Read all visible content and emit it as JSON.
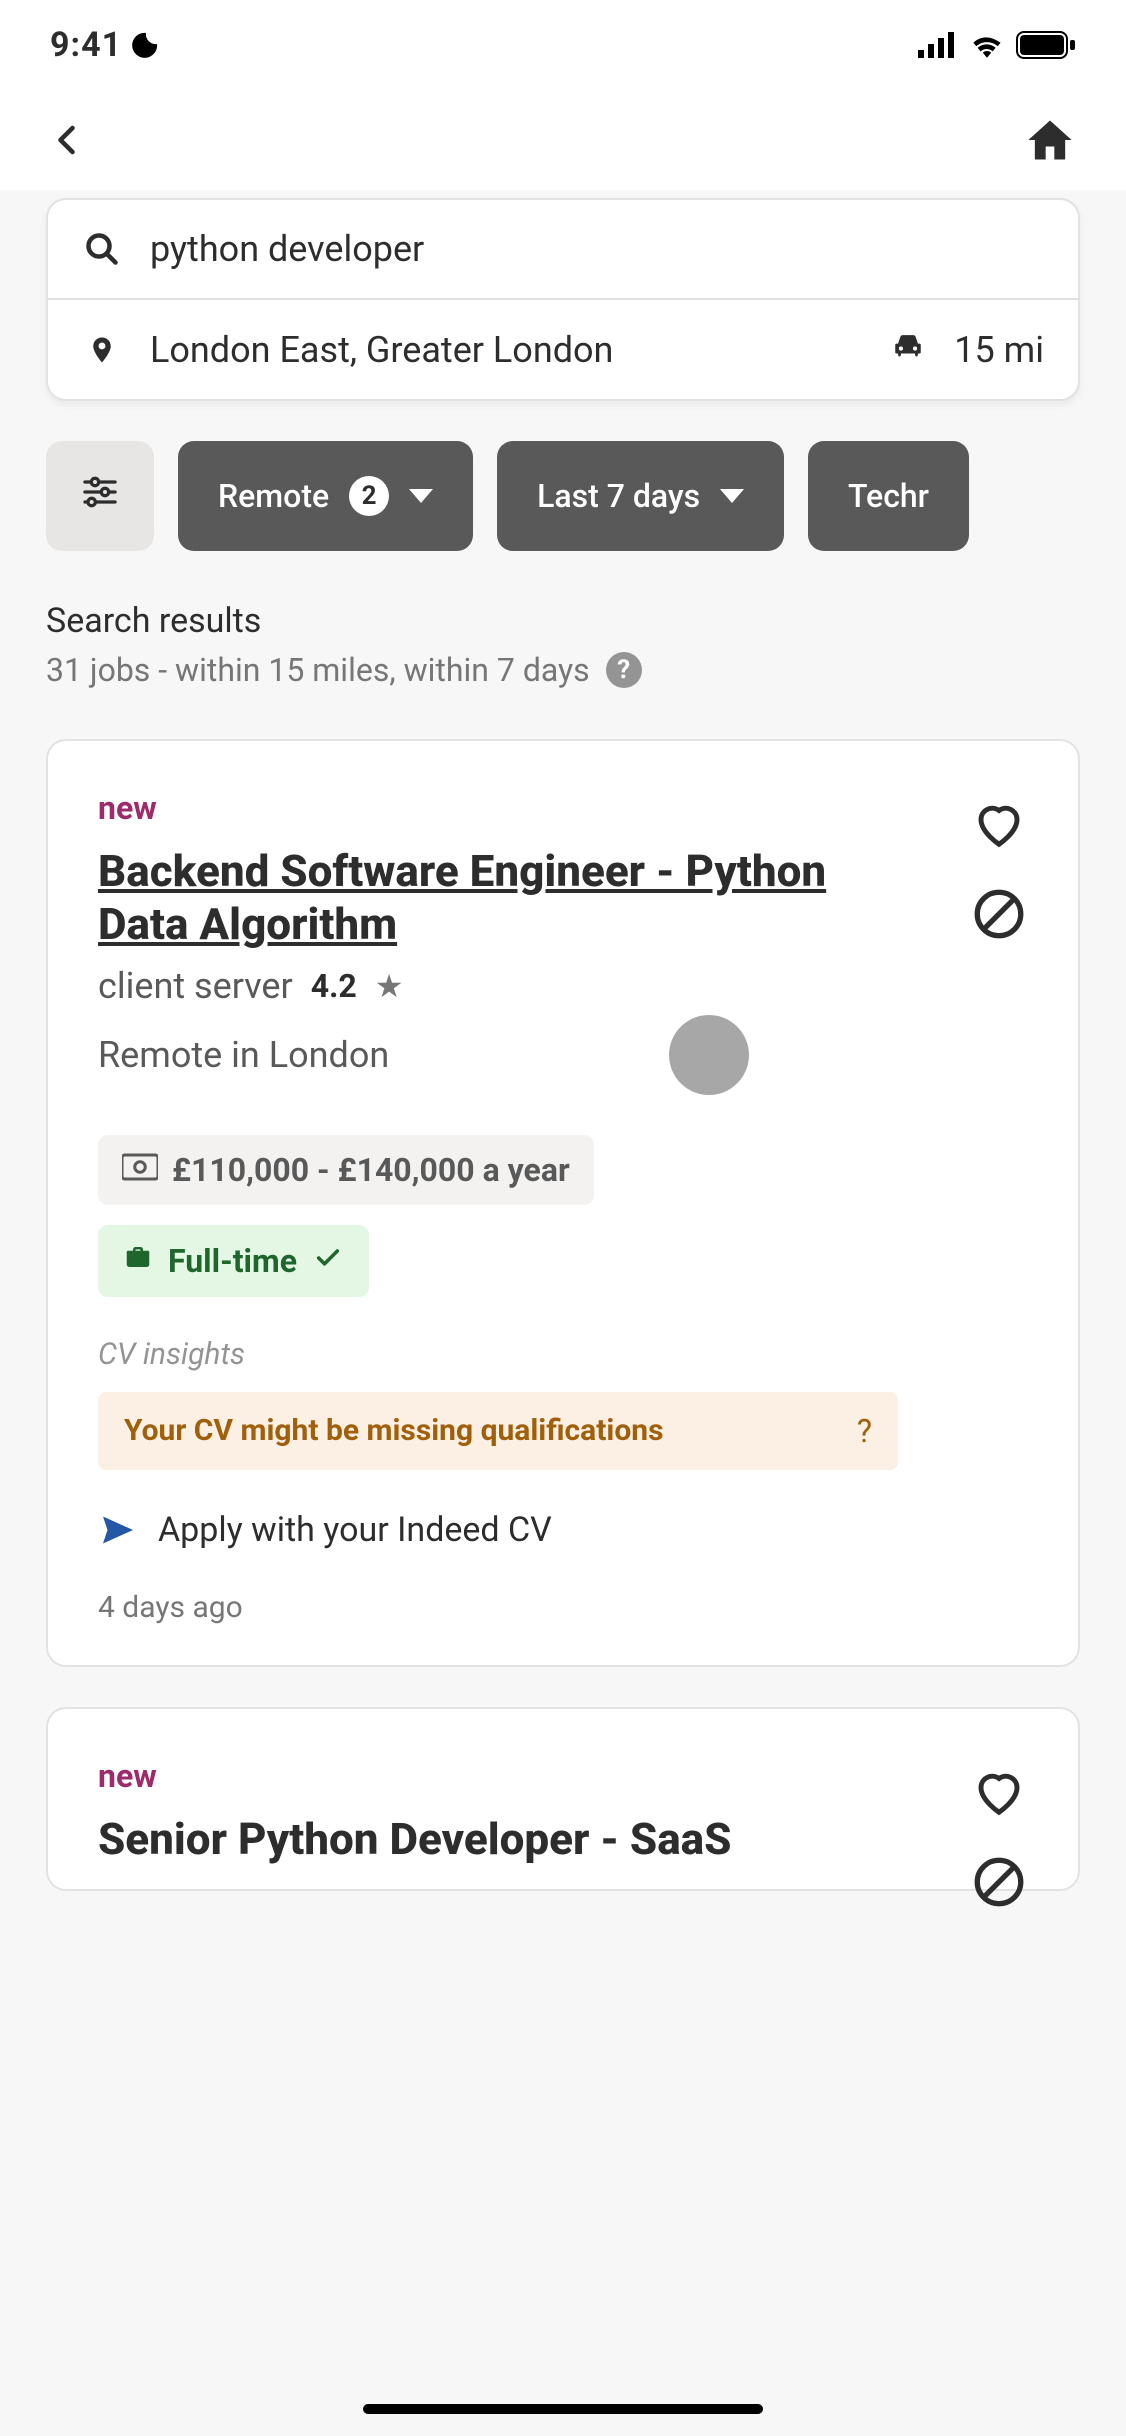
{
  "status": {
    "time": "9:41"
  },
  "search": {
    "query": "python developer",
    "location": "London East, Greater London",
    "radius_label": "15 mi"
  },
  "filters": {
    "remote_label": "Remote",
    "remote_count": "2",
    "date_label": "Last 7 days",
    "tech_partial": "Techr"
  },
  "results_header": {
    "title": "Search results",
    "subtitle": "31 jobs - within 15 miles, within 7 days"
  },
  "jobs": [
    {
      "new_label": "new",
      "title": "Backend Software Engineer - Python Data Algorithm",
      "company": "client server",
      "rating": "4.2",
      "location": "Remote in London",
      "salary": "£110,000 - £140,000 a year",
      "type": "Full-time",
      "insights_label": "CV insights",
      "insights_warning": "Your CV might be missing qualifications",
      "apply_label": "Apply with your Indeed CV",
      "posted": "4 days ago"
    },
    {
      "new_label": "new",
      "title": "Senior Python Developer - SaaS"
    }
  ]
}
